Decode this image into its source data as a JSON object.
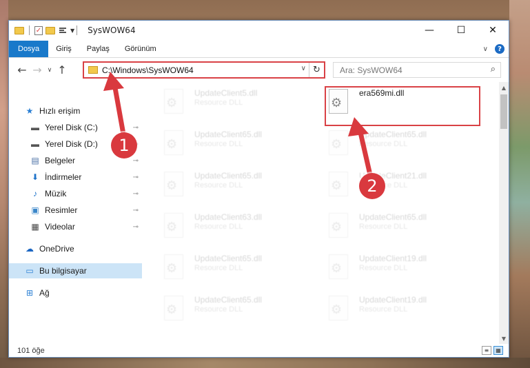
{
  "window": {
    "title": "SysWOW64",
    "min_glyph": "—",
    "max_glyph": "☐",
    "close_glyph": "✕"
  },
  "ribbon": {
    "tabs": [
      "Dosya",
      "Giriş",
      "Paylaş",
      "Görünüm"
    ],
    "chevron": "∨",
    "help": "?"
  },
  "address": {
    "path": "C:\\Windows\\SysWOW64",
    "dropdown": "∨",
    "refresh": "↻"
  },
  "search": {
    "placeholder": "Ara: SysWOW64",
    "icon": "⌕"
  },
  "nav": {
    "back": "←",
    "forward": "→",
    "recent": "∨",
    "up": "↑"
  },
  "sidebar": {
    "items": [
      {
        "label": "Hızlı erişim",
        "icon": "star-icon",
        "glyph": "★",
        "color": "#2a7fd4",
        "pinned": false
      },
      {
        "label": "Yerel Disk (C:)",
        "icon": "drive-icon",
        "glyph": "▬",
        "color": "#555555",
        "pinned": true
      },
      {
        "label": "Yerel Disk (D:)",
        "icon": "drive-icon",
        "glyph": "▬",
        "color": "#555555",
        "pinned": true
      },
      {
        "label": "Belgeler",
        "icon": "documents-icon",
        "glyph": "▤",
        "color": "#4a6fa5",
        "pinned": true
      },
      {
        "label": "İndirmeler",
        "icon": "download-icon",
        "glyph": "⬇",
        "color": "#1f73c9",
        "pinned": true
      },
      {
        "label": "Müzik",
        "icon": "music-icon",
        "glyph": "♪",
        "color": "#1f73c9",
        "pinned": true
      },
      {
        "label": "Resimler",
        "icon": "pictures-icon",
        "glyph": "▣",
        "color": "#3a86c9",
        "pinned": true
      },
      {
        "label": "Videolar",
        "icon": "video-icon",
        "glyph": "▦",
        "color": "#444444",
        "pinned": true
      },
      {
        "label": "OneDrive",
        "icon": "cloud-icon",
        "glyph": "☁",
        "color": "#1a65c2",
        "pinned": false
      },
      {
        "label": "Bu bilgisayar",
        "icon": "computer-icon",
        "glyph": "▭",
        "color": "#2a7fd4",
        "pinned": false
      },
      {
        "label": "Ağ",
        "icon": "network-icon",
        "glyph": "⊞",
        "color": "#2a7fd4",
        "pinned": false
      }
    ],
    "pin_glyph": "📌"
  },
  "files": [
    {
      "name": "UpdateClient5.dll",
      "type": "Resource DLL",
      "ghost": true
    },
    {
      "name": "era569mi.dll",
      "type": "",
      "ghost": false
    },
    {
      "name": "UpdateClient65.dll",
      "type": "Resource DLL",
      "ghost": true
    },
    {
      "name": "UpdateClient65.dll",
      "type": "Resource DLL",
      "ghost": true
    },
    {
      "name": "UpdateClient65.dll",
      "type": "Resource DLL",
      "ghost": true
    },
    {
      "name": "UpdateClient21.dll",
      "type": "Resource DLL",
      "ghost": true
    },
    {
      "name": "UpdateClient63.dll",
      "type": "Resource DLL",
      "ghost": true
    },
    {
      "name": "UpdateClient65.dll",
      "type": "Resource DLL",
      "ghost": true
    },
    {
      "name": "UpdateClient65.dll",
      "type": "Resource DLL",
      "ghost": true
    },
    {
      "name": "UpdateClient19.dll",
      "type": "Resource DLL",
      "ghost": true
    },
    {
      "name": "UpdateClient65.dll",
      "type": "Resource DLL",
      "ghost": true
    },
    {
      "name": "UpdateClient19.dll",
      "type": "Resource DLL",
      "ghost": true
    }
  ],
  "status": {
    "count": "101 öğe"
  },
  "annotations": {
    "step1": "1",
    "step2": "2",
    "color": "#d9393e"
  }
}
